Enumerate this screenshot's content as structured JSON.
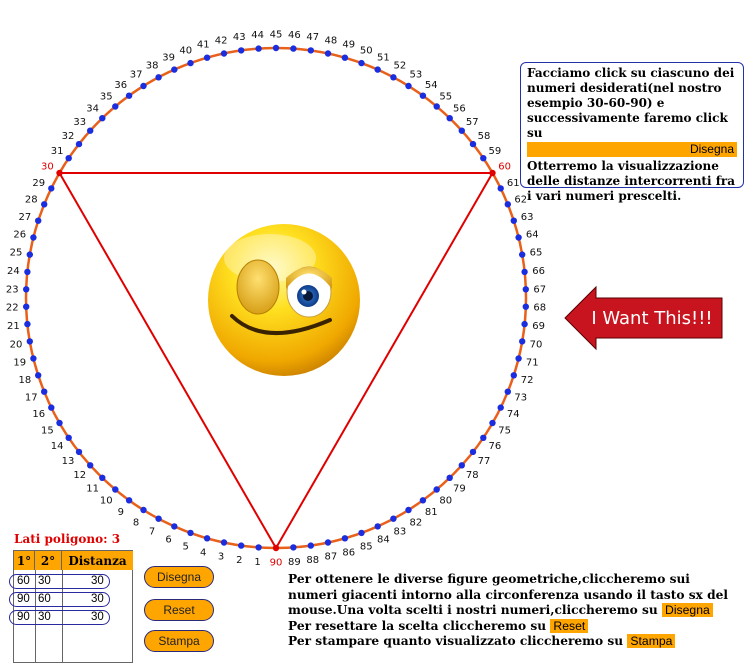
{
  "circle": {
    "labels": [
      "1",
      "2",
      "3",
      "4",
      "5",
      "6",
      "7",
      "8",
      "9",
      "10",
      "11",
      "12",
      "13",
      "14",
      "15",
      "16",
      "17",
      "18",
      "19",
      "20",
      "21",
      "22",
      "23",
      "24",
      "25",
      "26",
      "27",
      "28",
      "29",
      "30",
      "31",
      "32",
      "33",
      "34",
      "35",
      "36",
      "37",
      "38",
      "39",
      "40",
      "41",
      "42",
      "43",
      "44",
      "45",
      "46",
      "47",
      "48",
      "49",
      "50",
      "51",
      "52",
      "53",
      "54",
      "55",
      "56",
      "57",
      "58",
      "59",
      "60",
      "61",
      "62",
      "63",
      "64",
      "65",
      "66",
      "67",
      "68",
      "69",
      "70",
      "71",
      "72",
      "73",
      "74",
      "75",
      "76",
      "77",
      "78",
      "79",
      "80",
      "81",
      "82",
      "83",
      "84",
      "85",
      "86",
      "87",
      "88",
      "89",
      "90"
    ],
    "selected": [
      "30",
      "60",
      "90"
    ],
    "circle_color": "#e8601a",
    "dot_color": "#1a2ee0",
    "selected_color": "#e00000",
    "line_color": "#e00000"
  },
  "info_box": {
    "text1": "Facciamo click su ciascuno dei numeri desiderati(nel nostro esempio 30-60-90) e successivamente faremo click su",
    "button": "Disegna",
    "text2": "Otterremo la visualizzazione delle distanze intercorrenti fra i vari numeri prescelti."
  },
  "arrow": {
    "label": "I Want This!!!",
    "color": "#c8141e"
  },
  "buttons": {
    "draw": "Disegna",
    "reset": "Reset",
    "print": "Stampa"
  },
  "polygon": {
    "label": "Lati poligono: 3"
  },
  "table": {
    "headers": [
      "1°",
      "2°",
      "Distanza"
    ],
    "rows": [
      {
        "a": "60",
        "b": "30",
        "d": "30"
      },
      {
        "a": "90",
        "b": "60",
        "d": "30"
      },
      {
        "a": "90",
        "b": "30",
        "d": "30"
      }
    ]
  },
  "instructions": {
    "line1": "Per ottenere le diverse figure geometriche,cliccheremo sui numeri giacenti intorno alla circonferenza usando il tasto sx del mouse.Una volta scelti i nostri numeri,cliccheremo su",
    "line1_button": "Disegna",
    "line2": "Per resettare la scelta cliccheremo su",
    "line2_button": "Reset",
    "line3": "Per stampare quanto visualizzato cliccheremo su",
    "line3_button": "Stampa"
  }
}
